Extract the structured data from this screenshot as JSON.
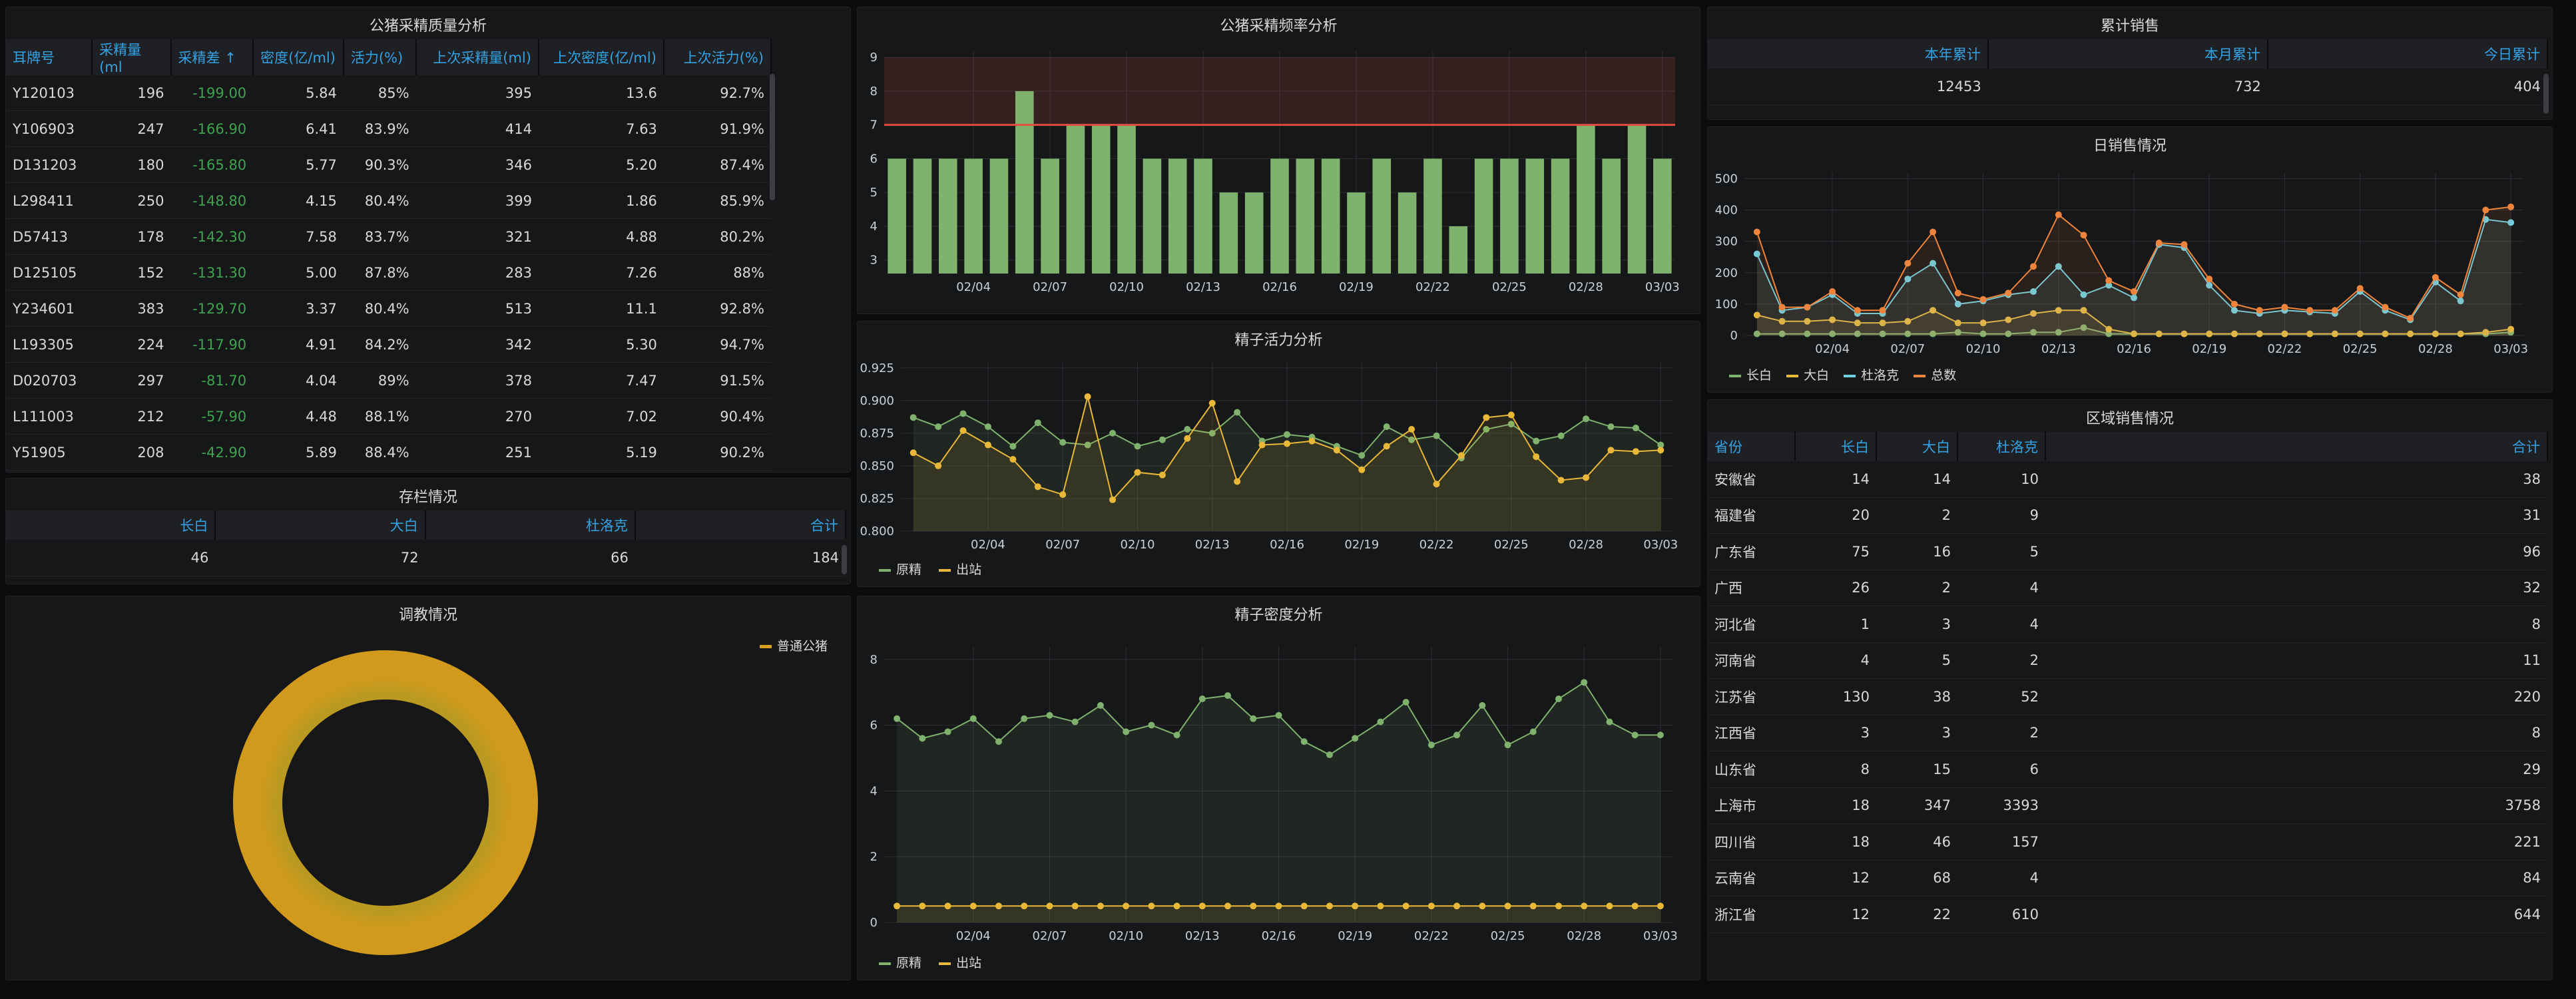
{
  "quality": {
    "title": "公猪采精质量分析",
    "columns": [
      "耳牌号",
      "采精量(ml",
      "采精差 ↑",
      "密度(亿/ml)",
      "活力(%)",
      "上次采精量(ml)",
      "上次密度(亿/ml)",
      "上次活力(%)"
    ],
    "rows": [
      [
        "Y120103",
        "196",
        "-199.00",
        "5.84",
        "85%",
        "395",
        "13.6",
        "92.7%"
      ],
      [
        "Y106903",
        "247",
        "-166.90",
        "6.41",
        "83.9%",
        "414",
        "7.63",
        "91.9%"
      ],
      [
        "D131203",
        "180",
        "-165.80",
        "5.77",
        "90.3%",
        "346",
        "5.20",
        "87.4%"
      ],
      [
        "L298411",
        "250",
        "-148.80",
        "4.15",
        "80.4%",
        "399",
        "1.86",
        "85.9%"
      ],
      [
        "D57413",
        "178",
        "-142.30",
        "7.58",
        "83.7%",
        "321",
        "4.88",
        "80.2%"
      ],
      [
        "D125105",
        "152",
        "-131.30",
        "5.00",
        "87.8%",
        "283",
        "7.26",
        "88%"
      ],
      [
        "Y234601",
        "383",
        "-129.70",
        "3.37",
        "80.4%",
        "513",
        "11.1",
        "92.8%"
      ],
      [
        "L193305",
        "224",
        "-117.90",
        "4.91",
        "84.2%",
        "342",
        "5.30",
        "94.7%"
      ],
      [
        "D020703",
        "297",
        "-81.70",
        "4.04",
        "89%",
        "378",
        "7.47",
        "91.5%"
      ],
      [
        "L111003",
        "212",
        "-57.90",
        "4.48",
        "88.1%",
        "270",
        "7.02",
        "90.4%"
      ],
      [
        "Y51905",
        "208",
        "-42.90",
        "5.89",
        "88.4%",
        "251",
        "5.19",
        "90.2%"
      ]
    ]
  },
  "stock": {
    "title": "存栏情况",
    "columns": [
      "长白",
      "大白",
      "杜洛克",
      "合计"
    ],
    "values": [
      "46",
      "72",
      "66",
      "184"
    ]
  },
  "training": {
    "title": "调教情况",
    "legend": "普通公猪",
    "chart_data": {
      "type": "pie",
      "donut": true,
      "slices": [
        {
          "name": "普通公猪",
          "value": 1
        }
      ],
      "colors": {
        "ring": "#d6a21e"
      }
    }
  },
  "freq": {
    "title": "公猪采精频率分析",
    "chart_data": {
      "type": "bar",
      "x": [
        "02/01",
        "02/02",
        "02/03",
        "02/04",
        "02/05",
        "02/06",
        "02/07",
        "02/08",
        "02/09",
        "02/10",
        "02/11",
        "02/12",
        "02/13",
        "02/14",
        "02/15",
        "02/16",
        "02/17",
        "02/18",
        "02/19",
        "02/20",
        "02/21",
        "02/22",
        "02/23",
        "02/24",
        "02/25",
        "02/26",
        "02/27",
        "02/28",
        "03/01",
        "03/02",
        "03/03"
      ],
      "values": [
        6,
        6,
        6,
        6,
        6,
        8,
        6,
        7,
        7,
        7,
        6,
        6,
        6,
        5,
        5,
        6,
        6,
        6,
        5,
        6,
        5,
        6,
        4,
        6,
        6,
        6,
        6,
        7,
        6,
        7,
        6
      ],
      "xticks": [
        "02/04",
        "02/07",
        "02/10",
        "02/13",
        "02/16",
        "02/19",
        "02/22",
        "02/25",
        "02/28",
        "03/03"
      ],
      "yticks": [
        3,
        4,
        5,
        6,
        7,
        8,
        9
      ],
      "ylim": [
        2.6,
        9.2
      ],
      "threshold": 7,
      "colors": {
        "bar": "#7eb26d",
        "threshold": "#e24d42"
      }
    }
  },
  "vitality": {
    "title": "精子活力分析",
    "legend": [
      "原精",
      "出站"
    ],
    "chart_data": {
      "type": "line",
      "x": [
        "02/01",
        "02/02",
        "02/03",
        "02/04",
        "02/05",
        "02/06",
        "02/07",
        "02/08",
        "02/09",
        "02/10",
        "02/11",
        "02/12",
        "02/13",
        "02/14",
        "02/15",
        "02/16",
        "02/17",
        "02/18",
        "02/19",
        "02/20",
        "02/21",
        "02/22",
        "02/23",
        "02/24",
        "02/25",
        "02/26",
        "02/27",
        "02/28",
        "03/01",
        "03/02",
        "03/03"
      ],
      "series": [
        {
          "name": "原精",
          "values": [
            0.887,
            0.88,
            0.89,
            0.88,
            0.865,
            0.883,
            0.868,
            0.866,
            0.875,
            0.865,
            0.87,
            0.878,
            0.875,
            0.891,
            0.869,
            0.874,
            0.872,
            0.865,
            0.858,
            0.88,
            0.87,
            0.873,
            0.856,
            0.878,
            0.882,
            0.869,
            0.873,
            0.886,
            0.88,
            0.879,
            0.866
          ]
        },
        {
          "name": "出站",
          "values": [
            0.86,
            0.85,
            0.877,
            0.866,
            0.855,
            0.834,
            0.828,
            0.903,
            0.824,
            0.845,
            0.843,
            0.871,
            0.898,
            0.838,
            0.866,
            0.867,
            0.869,
            0.862,
            0.847,
            0.865,
            0.878,
            0.836,
            0.858,
            0.887,
            0.889,
            0.857,
            0.839,
            0.841,
            0.862,
            0.861,
            0.862
          ]
        }
      ],
      "xticks": [
        "02/04",
        "02/07",
        "02/10",
        "02/13",
        "02/16",
        "02/19",
        "02/22",
        "02/25",
        "02/28",
        "03/03"
      ],
      "yticks": [
        "0.800",
        "0.825",
        "0.850",
        "0.875",
        "0.900",
        "0.925"
      ],
      "ylim": [
        0.8,
        0.93
      ],
      "colors": {
        "原精": "#7eb26d",
        "出站": "#eab839"
      }
    }
  },
  "density": {
    "title": "精子密度分析",
    "legend": [
      "原精",
      "出站"
    ],
    "chart_data": {
      "type": "line",
      "x": [
        "02/01",
        "02/02",
        "02/03",
        "02/04",
        "02/05",
        "02/06",
        "02/07",
        "02/08",
        "02/09",
        "02/10",
        "02/11",
        "02/12",
        "02/13",
        "02/14",
        "02/15",
        "02/16",
        "02/17",
        "02/18",
        "02/19",
        "02/20",
        "02/21",
        "02/22",
        "02/23",
        "02/24",
        "02/25",
        "02/26",
        "02/27",
        "02/28",
        "03/01",
        "03/02",
        "03/03"
      ],
      "series": [
        {
          "name": "原精",
          "values": [
            6.2,
            5.6,
            5.8,
            6.2,
            5.5,
            6.2,
            6.3,
            6.1,
            6.6,
            5.8,
            6.0,
            5.7,
            6.8,
            6.9,
            6.2,
            6.3,
            5.5,
            5.1,
            5.6,
            6.1,
            6.7,
            5.4,
            5.7,
            6.6,
            5.4,
            5.8,
            6.8,
            7.3,
            6.1,
            5.7,
            5.7
          ]
        },
        {
          "name": "出站",
          "values": [
            0.5,
            0.5,
            0.5,
            0.5,
            0.5,
            0.5,
            0.5,
            0.5,
            0.5,
            0.5,
            0.5,
            0.5,
            0.5,
            0.5,
            0.5,
            0.5,
            0.5,
            0.5,
            0.5,
            0.5,
            0.5,
            0.5,
            0.5,
            0.5,
            0.5,
            0.5,
            0.5,
            0.5,
            0.5,
            0.5,
            0.5
          ]
        }
      ],
      "xticks": [
        "02/04",
        "02/07",
        "02/10",
        "02/13",
        "02/16",
        "02/19",
        "02/22",
        "02/25",
        "02/28",
        "03/03"
      ],
      "yticks": [
        "0",
        "2",
        "4",
        "6",
        "8"
      ],
      "ylim": [
        0,
        8.4
      ],
      "colors": {
        "原精": "#7eb26d",
        "出站": "#eab839"
      }
    }
  },
  "cumulative": {
    "title": "累计销售",
    "columns": [
      "本年累计",
      "本月累计",
      "今日累计"
    ],
    "values": [
      "12453",
      "732",
      "404"
    ]
  },
  "daily": {
    "title": "日销售情况",
    "legend": [
      "长白",
      "大白",
      "杜洛克",
      "总数"
    ],
    "chart_data": {
      "type": "line",
      "x": [
        "02/01",
        "02/02",
        "02/03",
        "02/04",
        "02/05",
        "02/06",
        "02/07",
        "02/08",
        "02/09",
        "02/10",
        "02/11",
        "02/12",
        "02/13",
        "02/14",
        "02/15",
        "02/16",
        "02/17",
        "02/18",
        "02/19",
        "02/20",
        "02/21",
        "02/22",
        "02/23",
        "02/24",
        "02/25",
        "02/26",
        "02/27",
        "02/28",
        "03/01",
        "03/02",
        "03/03"
      ],
      "series": [
        {
          "name": "长白",
          "values": [
            5,
            5,
            5,
            5,
            5,
            5,
            5,
            5,
            10,
            5,
            5,
            10,
            10,
            25,
            5,
            5,
            5,
            5,
            5,
            5,
            5,
            5,
            5,
            5,
            5,
            5,
            5,
            5,
            5,
            5,
            10
          ]
        },
        {
          "name": "大白",
          "values": [
            65,
            45,
            45,
            50,
            40,
            40,
            45,
            80,
            40,
            40,
            50,
            70,
            80,
            80,
            20,
            5,
            5,
            5,
            5,
            5,
            5,
            5,
            5,
            5,
            5,
            5,
            5,
            5,
            5,
            10,
            20
          ]
        },
        {
          "name": "杜洛克",
          "values": [
            260,
            80,
            90,
            130,
            70,
            70,
            180,
            230,
            100,
            110,
            130,
            140,
            220,
            130,
            160,
            120,
            290,
            280,
            160,
            80,
            70,
            80,
            75,
            70,
            140,
            80,
            50,
            170,
            110,
            370,
            360
          ]
        },
        {
          "name": "总数",
          "values": [
            330,
            90,
            90,
            140,
            80,
            80,
            230,
            330,
            135,
            115,
            135,
            220,
            385,
            320,
            175,
            140,
            295,
            290,
            180,
            100,
            80,
            90,
            80,
            80,
            150,
            90,
            55,
            185,
            130,
            400,
            410
          ]
        }
      ],
      "xticks": [
        "02/04",
        "02/07",
        "02/10",
        "02/13",
        "02/16",
        "02/19",
        "02/22",
        "02/25",
        "02/28",
        "03/03"
      ],
      "yticks": [
        "0",
        "100",
        "200",
        "300",
        "400",
        "500"
      ],
      "ylim": [
        0,
        520
      ],
      "colors": {
        "长白": "#7eb26d",
        "大白": "#eab839",
        "杜洛克": "#6ed0e0",
        "总数": "#ef843c"
      }
    }
  },
  "region": {
    "title": "区域销售情况",
    "columns": [
      "省份",
      "长白",
      "大白",
      "杜洛克",
      "合计"
    ],
    "rows": [
      [
        "安徽省",
        "14",
        "14",
        "10",
        "38"
      ],
      [
        "福建省",
        "20",
        "2",
        "9",
        "31"
      ],
      [
        "广东省",
        "75",
        "16",
        "5",
        "96"
      ],
      [
        "广西",
        "26",
        "2",
        "4",
        "32"
      ],
      [
        "河北省",
        "1",
        "3",
        "4",
        "8"
      ],
      [
        "河南省",
        "4",
        "5",
        "2",
        "11"
      ],
      [
        "江苏省",
        "130",
        "38",
        "52",
        "220"
      ],
      [
        "江西省",
        "3",
        "3",
        "2",
        "8"
      ],
      [
        "山东省",
        "8",
        "15",
        "6",
        "29"
      ],
      [
        "上海市",
        "18",
        "347",
        "3393",
        "3758"
      ],
      [
        "四川省",
        "18",
        "46",
        "157",
        "221"
      ],
      [
        "云南省",
        "12",
        "68",
        "4",
        "84"
      ],
      [
        "浙江省",
        "12",
        "22",
        "610",
        "644"
      ]
    ]
  }
}
